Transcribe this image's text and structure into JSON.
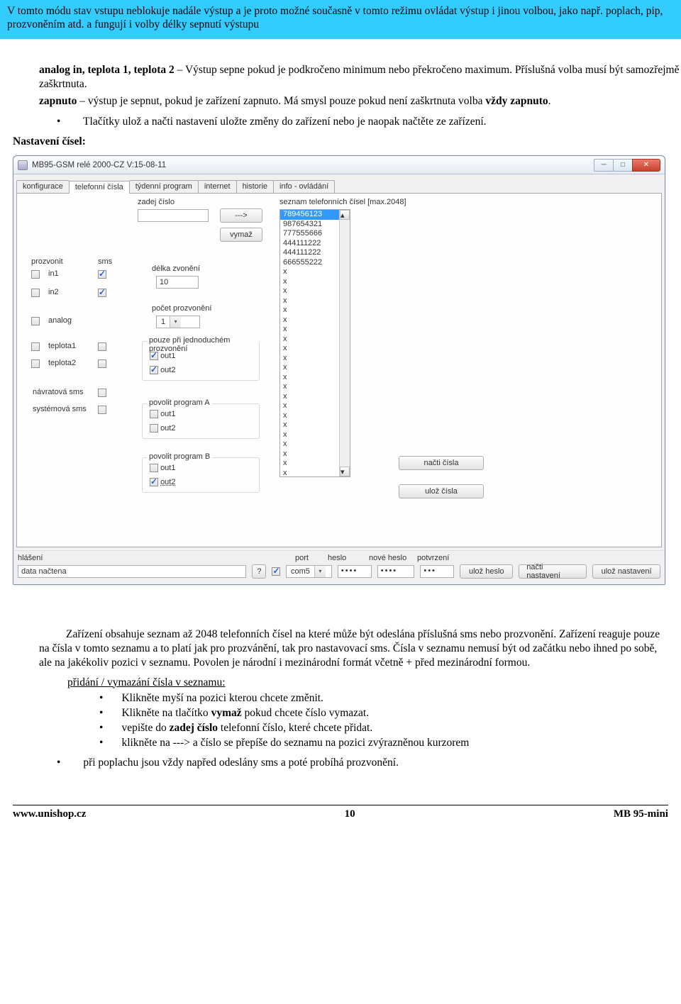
{
  "doc": {
    "blue_box": "V tomto módu stav vstupu neblokuje nadále výstup a je proto možné současně v tomto režimu ovládat výstup i jinou volbou, jako např. poplach, pip, prozvoněním atd. a fungují i volby délky sepnutí výstupu",
    "p1a": "analog in, teplota 1, teplota 2",
    "p1b": " – Výstup sepne pokud je podkročeno minimum nebo překročeno maximum. Příslušná volba musí být samozřejmě zaškrtnuta.",
    "p2a": "zapnuto",
    "p2b": " – výstup je sepnut, pokud je zařízení zapnuto. Má smysl pouze pokud není zaškrtnuta volba ",
    "p2c": "vždy zapnuto",
    "p2d": ".",
    "bullet1": "Tlačítky ulož a načti nastavení uložte změny do zařízení nebo je naopak načtěte ze zařízení.",
    "section": "Nastavení čísel:",
    "after1": "Zařízení obsahuje seznam až 2048 telefonních čísel na které může být odeslána příslušná sms nebo prozvonění. Zařízení reaguje pouze na čísla v tomto seznamu a to platí jak pro prozvánění, tak pro nastavovací sms. Čísla v seznamu nemusí být od začátku nebo ihned po sobě, ale na jakékoliv pozici v seznamu. Povolen je národní i mezinárodní formát včetně + před mezinárodní formou.",
    "subheading": "přidání / vymazání čísla v seznamu:",
    "sb1": "Klikněte myší na pozici kterou chcete změnit.",
    "sb2a": "Klikněte na tlačítko ",
    "sb2b": "vymaž",
    "sb2c": " pokud chcete číslo vymazat.",
    "sb3a": "vepište do ",
    "sb3b": "zadej číslo",
    "sb3c": "  telefonní číslo, které chcete přidat.",
    "sb4": "klikněte na ---> a číslo se přepíše do seznamu na pozici zvýrazněnou kurzorem",
    "outer_bullet": "při poplachu jsou vždy napřed odeslány sms a poté probíhá prozvonění.",
    "footer_left": "www.unishop.cz",
    "footer_mid": "10",
    "footer_right": "MB 95-mini"
  },
  "app": {
    "title": "MB95-GSM relé 2000-CZ V:15-08-11",
    "tabs": [
      "konfigurace",
      "telefonní čísla",
      "týdenní program",
      "internet",
      "historie",
      "info - ovládání"
    ],
    "zadej_label": "zadej číslo",
    "arrow_btn": "--->",
    "vymaz_btn": "vymaž",
    "seznam_label": "seznam telefonních čísel [max.2048]",
    "col_prozvonit": "prozvonit",
    "col_sms": "sms",
    "rows": {
      "in1": "in1",
      "in2": "in2",
      "analog": "analog",
      "teplota1": "teplota1",
      "teplota2": "teplota2",
      "navratova": "návratová sms",
      "systemova": "systémová sms"
    },
    "delka_label": "délka zvonění",
    "delka_value": "10",
    "pocet_label": "počet prozvonění",
    "pocet_value": "1",
    "grp_jedno": "pouze při jednoduchém prozvonění",
    "grp_pa": "povolit program A",
    "grp_pb": "povolit program B",
    "out1": "out1",
    "out2": "out2",
    "list": [
      "789456123",
      "987654321",
      "777555666",
      "444111222",
      "444111222",
      "666555222",
      "x",
      "x",
      "x",
      "x",
      "x",
      "x",
      "x",
      "x",
      "x",
      "x",
      "x",
      "x",
      "x",
      "x",
      "x",
      "x",
      "x",
      "x",
      "x",
      "x",
      "x",
      "x"
    ],
    "btn_nacti": "načti čísla",
    "btn_uloz": "ulož čísla",
    "hlaseni_label": "hlášení",
    "hlaseni_value": "data načtena",
    "port_label": "port",
    "port_value": "com5",
    "heslo_label": "heslo",
    "noveheslo_label": "nové heslo",
    "potvrzeni_label": "potvrzení",
    "dots": "••••",
    "dots3": "•••",
    "btn_ulozheslo": "ulož heslo",
    "btn_nacti_n": "načti nastavení",
    "btn_uloz_n": "ulož nastavení",
    "qmark": "?"
  }
}
